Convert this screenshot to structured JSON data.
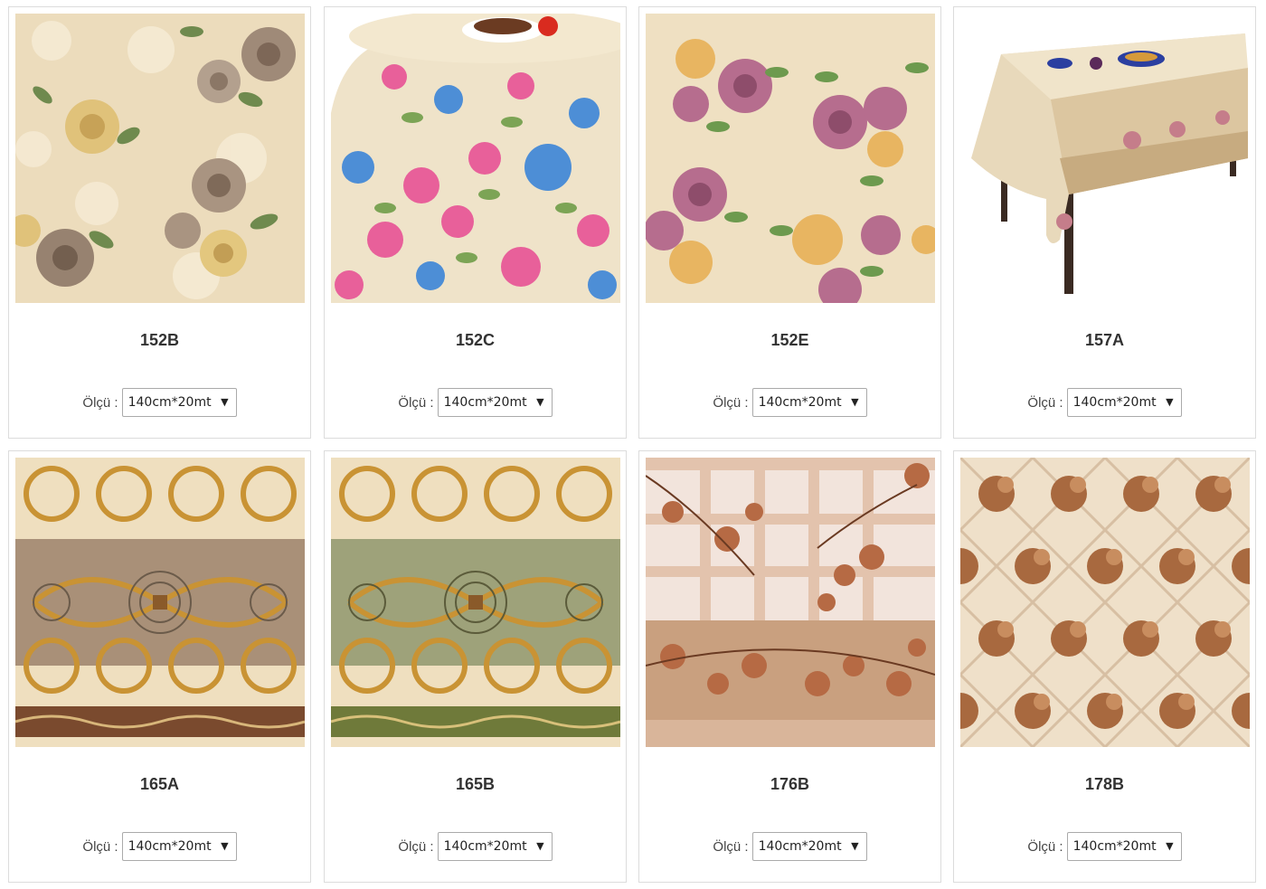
{
  "size_label": "Ölçü :",
  "products": [
    {
      "code": "152B",
      "size": "140cm*20mt",
      "image": "floral-beige-roses-swatch"
    },
    {
      "code": "152C",
      "size": "140cm*20mt",
      "image": "floral-round-tablecloth-photo"
    },
    {
      "code": "152E",
      "size": "140cm*20mt",
      "image": "floral-pink-roses-swatch"
    },
    {
      "code": "157A",
      "size": "140cm*20mt",
      "image": "tablecloth-on-table-photo"
    },
    {
      "code": "165A",
      "size": "140cm*20mt",
      "image": "baroque-brown-swatch"
    },
    {
      "code": "165B",
      "size": "140cm*20mt",
      "image": "baroque-green-swatch"
    },
    {
      "code": "176B",
      "size": "140cm*20mt",
      "image": "orchid-brown-grid-swatch"
    },
    {
      "code": "178B",
      "size": "140cm*20mt",
      "image": "floral-lattice-brown-swatch"
    }
  ],
  "colors": {
    "card_border": "#dcdcdc",
    "text": "#333333"
  }
}
